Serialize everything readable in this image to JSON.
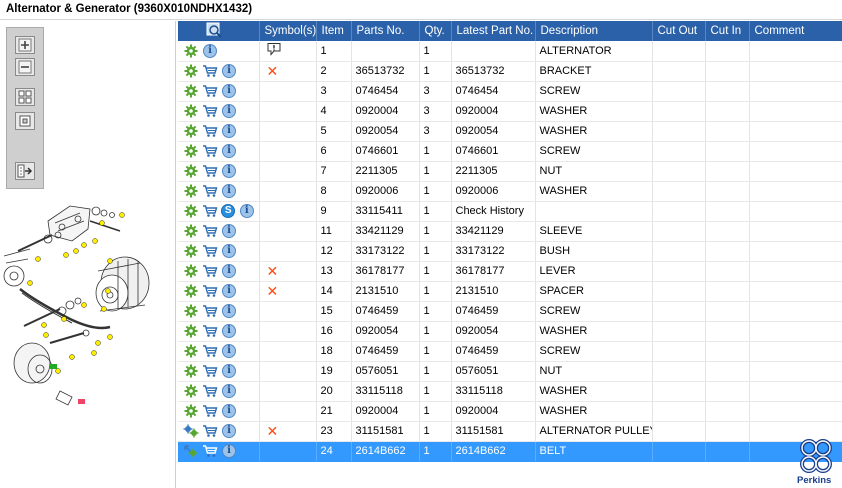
{
  "window": {
    "title": "Alternator & Generator (9360X010NDHX1432)"
  },
  "toolbar": {
    "zoom_in_icon": "zoom-in-icon",
    "zoom_out_icon": "zoom-out-icon",
    "fit_icon": "fit-view-icon",
    "actual_size_icon": "actual-size-icon",
    "export_icon": "export-icon"
  },
  "table": {
    "headers": [
      "",
      "Symbol(s)",
      "Item",
      "Parts No.",
      "Qty.",
      "Latest Part No.",
      "Description",
      "Cut Out",
      "Cut In",
      "Comment"
    ],
    "rows": [
      {
        "icons": [
          "gear",
          "info"
        ],
        "symbol": "speech",
        "item": "1",
        "part": "",
        "qty": "1",
        "latest": "",
        "desc": "ALTERNATOR"
      },
      {
        "icons": [
          "gear",
          "cart",
          "info"
        ],
        "symbol": "x",
        "item": "2",
        "part": "36513732",
        "qty": "1",
        "latest": "36513732",
        "desc": "BRACKET"
      },
      {
        "icons": [
          "gear",
          "cart",
          "info"
        ],
        "symbol": "",
        "item": "3",
        "part": "0746454",
        "qty": "3",
        "latest": "0746454",
        "desc": "SCREW"
      },
      {
        "icons": [
          "gear",
          "cart",
          "info"
        ],
        "symbol": "",
        "item": "4",
        "part": "0920004",
        "qty": "3",
        "latest": "0920004",
        "desc": "WASHER"
      },
      {
        "icons": [
          "gear",
          "cart",
          "info"
        ],
        "symbol": "",
        "item": "5",
        "part": "0920054",
        "qty": "3",
        "latest": "0920054",
        "desc": "WASHER"
      },
      {
        "icons": [
          "gear",
          "cart",
          "info"
        ],
        "symbol": "",
        "item": "6",
        "part": "0746601",
        "qty": "1",
        "latest": "0746601",
        "desc": "SCREW"
      },
      {
        "icons": [
          "gear",
          "cart",
          "info"
        ],
        "symbol": "",
        "item": "7",
        "part": "2211305",
        "qty": "1",
        "latest": "2211305",
        "desc": "NUT"
      },
      {
        "icons": [
          "gear",
          "cart",
          "info"
        ],
        "symbol": "",
        "item": "8",
        "part": "0920006",
        "qty": "1",
        "latest": "0920006",
        "desc": "WASHER"
      },
      {
        "icons": [
          "gear",
          "cart",
          "s",
          "info"
        ],
        "symbol": "",
        "item": "9",
        "part": "33115411",
        "qty": "1",
        "latest": "Check History",
        "desc": ""
      },
      {
        "icons": [
          "gear",
          "cart",
          "info"
        ],
        "symbol": "",
        "item": "11",
        "part": "33421129",
        "qty": "1",
        "latest": "33421129",
        "desc": "SLEEVE"
      },
      {
        "icons": [
          "gear",
          "cart",
          "info"
        ],
        "symbol": "",
        "item": "12",
        "part": "33173122",
        "qty": "1",
        "latest": "33173122",
        "desc": "BUSH"
      },
      {
        "icons": [
          "gear",
          "cart",
          "info"
        ],
        "symbol": "x",
        "item": "13",
        "part": "36178177",
        "qty": "1",
        "latest": "36178177",
        "desc": "LEVER"
      },
      {
        "icons": [
          "gear",
          "cart",
          "info"
        ],
        "symbol": "x",
        "item": "14",
        "part": "2131510",
        "qty": "1",
        "latest": "2131510",
        "desc": "SPACER"
      },
      {
        "icons": [
          "gear",
          "cart",
          "info"
        ],
        "symbol": "",
        "item": "15",
        "part": "0746459",
        "qty": "1",
        "latest": "0746459",
        "desc": "SCREW"
      },
      {
        "icons": [
          "gear",
          "cart",
          "info"
        ],
        "symbol": "",
        "item": "16",
        "part": "0920054",
        "qty": "1",
        "latest": "0920054",
        "desc": "WASHER"
      },
      {
        "icons": [
          "gear",
          "cart",
          "info"
        ],
        "symbol": "",
        "item": "18",
        "part": "0746459",
        "qty": "1",
        "latest": "0746459",
        "desc": "SCREW"
      },
      {
        "icons": [
          "gear",
          "cart",
          "info"
        ],
        "symbol": "",
        "item": "19",
        "part": "0576051",
        "qty": "1",
        "latest": "0576051",
        "desc": "NUT"
      },
      {
        "icons": [
          "gear",
          "cart",
          "info"
        ],
        "symbol": "",
        "item": "20",
        "part": "33115118",
        "qty": "1",
        "latest": "33115118",
        "desc": "WASHER"
      },
      {
        "icons": [
          "gear",
          "cart",
          "info"
        ],
        "symbol": "",
        "item": "21",
        "part": "0920004",
        "qty": "1",
        "latest": "0920004",
        "desc": "WASHER"
      },
      {
        "icons": [
          "gears",
          "cart",
          "info"
        ],
        "symbol": "x",
        "item": "23",
        "part": "31151581",
        "qty": "1",
        "latest": "31151581",
        "desc": "ALTERNATOR PULLEY"
      },
      {
        "icons": [
          "gear-arrow",
          "cart",
          "info"
        ],
        "symbol": "",
        "item": "24",
        "part": "2614B662",
        "qty": "1",
        "latest": "2614B662",
        "desc": "BELT",
        "selected": true
      }
    ]
  },
  "brand": {
    "name": "Perkins",
    "color": "#1a3f8c"
  },
  "colors": {
    "header": "#2b61a8",
    "selected": "#3399ff",
    "symbol": "#ff4a10"
  }
}
